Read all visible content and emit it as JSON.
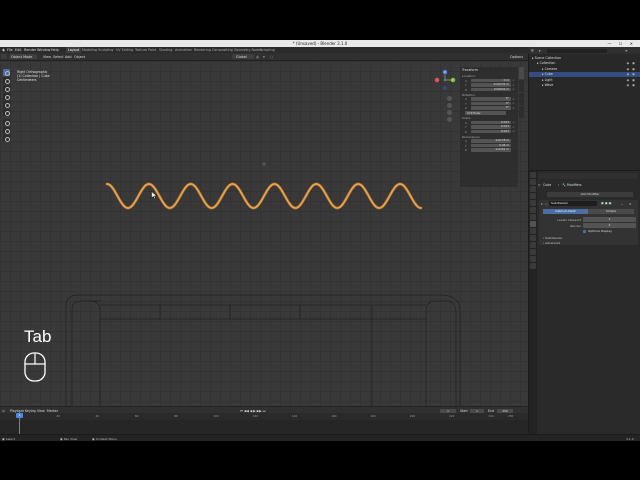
{
  "window": {
    "title": "* (Unsaved) - Blender 3.1.0",
    "controls": "— ☐ ✕"
  },
  "menubar": {
    "items": [
      "File",
      "Edit",
      "Render",
      "Window",
      "Help"
    ],
    "workspaces": [
      "Layout",
      "Modeling",
      "Sculpting",
      "UV Editing",
      "Texture Paint",
      "Shading",
      "Animation",
      "Rendering",
      "Compositing",
      "Geometry Nodes",
      "Scripting"
    ],
    "active_workspace": "Layout",
    "scene_label": "Scene",
    "viewlayer_label": "ViewLayer"
  },
  "viewport_header": {
    "mode": "Object Mode",
    "menus": [
      "View",
      "Select",
      "Add",
      "Object"
    ],
    "transform_orientation": "Global",
    "options_label": "Options"
  },
  "viewport_overlay": {
    "line1": "Right Orthographic",
    "line2": "(1) Collection | Cube",
    "line3": "Centimeters"
  },
  "gizmo": {
    "x": "X",
    "y": "Y",
    "z": "Z"
  },
  "npanel": {
    "header": "Transform",
    "location_label": "Location:",
    "location": [
      {
        "axis": "X",
        "value": "0 m"
      },
      {
        "axis": "Y",
        "value": "-0.00232 m"
      },
      {
        "axis": "Z",
        "value": "0.00632 m"
      }
    ],
    "rotation_label": "Rotation:",
    "rotation": [
      {
        "axis": "X",
        "value": "0°"
      },
      {
        "axis": "Y",
        "value": "0°"
      },
      {
        "axis": "Z",
        "value": "0°"
      }
    ],
    "rotation_mode": "XYZ Euler",
    "scale_label": "Scale:",
    "scale": [
      {
        "axis": "X",
        "value": "0.023"
      },
      {
        "axis": "Y",
        "value": "0.023"
      },
      {
        "axis": "Z",
        "value": "0.023"
      }
    ],
    "dimensions_label": "Dimensions:",
    "dimensions": [
      {
        "axis": "X",
        "value": "0.0178 m"
      },
      {
        "axis": "Y",
        "value": "0.46 m"
      },
      {
        "axis": "Z",
        "value": "0.0261 m"
      }
    ],
    "tabs": [
      "Item",
      "Tool",
      "View",
      "Edit"
    ]
  },
  "overlay_hint": {
    "key_label": "Tab"
  },
  "timeline": {
    "menus": [
      "Playback",
      "Keying",
      "View",
      "Marker"
    ],
    "current_frame": "1",
    "start_label": "Start",
    "start_value": "1",
    "end_label": "End",
    "end_value": "250",
    "ticks": [
      "0",
      "20",
      "40",
      "60",
      "80",
      "100",
      "120",
      "140",
      "160",
      "180",
      "200",
      "220",
      "240",
      "250"
    ],
    "play_controls": "⏮ ◀◀ ◀ ▶ ▶▶ ⏭"
  },
  "statusbar": {
    "items": [
      "Select",
      "Pan View",
      "Context Menu"
    ],
    "version": "3.1.0"
  },
  "outliner": {
    "search_placeholder": "",
    "rows": [
      {
        "text": "Scene Collection",
        "indent": 0,
        "selected": false
      },
      {
        "text": "Collection",
        "indent": 1,
        "selected": false
      },
      {
        "text": "Camera",
        "indent": 2,
        "selected": false
      },
      {
        "text": "Cube",
        "indent": 2,
        "selected": true
      },
      {
        "text": "Light",
        "indent": 2,
        "selected": false
      },
      {
        "text": "Wave",
        "indent": 2,
        "selected": false
      }
    ]
  },
  "properties": {
    "object_name": "Cube",
    "active_tab": "Modifiers",
    "add_modifier_label": "Add Modifier",
    "modifier": {
      "name": "Subdivision",
      "mode_simple": "Catmull-Clark",
      "mode_other": "Simple",
      "levels_viewport_label": "Levels Viewport",
      "levels_viewport": "1",
      "render_label": "Render",
      "render": "2",
      "optimal_display_label": "Optimal Display",
      "advanced_label": "Advanced",
      "subdivision_label": "Subdivision"
    }
  },
  "colors": {
    "selection_orange": "#e8a14a",
    "active_blue": "#4a6fa5",
    "viewport_bg": "#393939",
    "header_bg": "#303030"
  }
}
